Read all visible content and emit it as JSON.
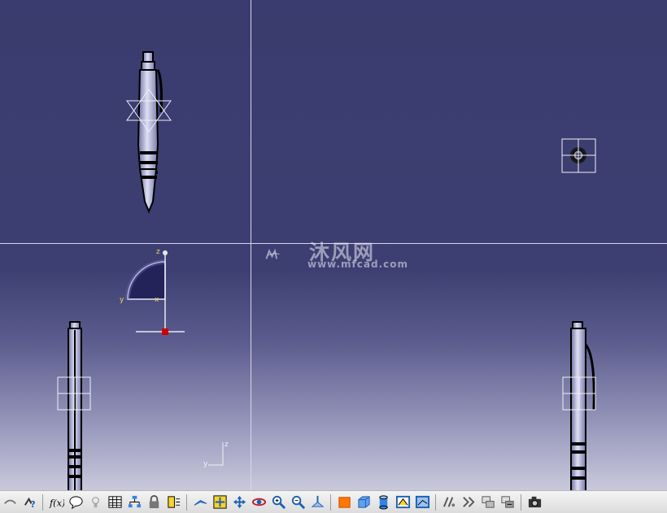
{
  "window": {
    "app": "3D CAD part viewer",
    "layout": "four-view"
  },
  "watermark": {
    "brand": "沐风网",
    "url": "www.mfcad.com"
  },
  "compass": {
    "x_label": "x",
    "y_label": "y",
    "z_label": "z"
  },
  "triad": {
    "y_label": "y",
    "z_label": "z"
  },
  "views": [
    {
      "name": "top-left",
      "content": "pen-front-view"
    },
    {
      "name": "top-right",
      "content": "pen-end-view"
    },
    {
      "name": "bottom-left",
      "content": "pen-side-view"
    },
    {
      "name": "bottom-right",
      "content": "pen-clip-view"
    }
  ],
  "toolbar": {
    "icons": [
      "link-icon",
      "help-icon",
      "formula-icon",
      "comment-icon",
      "light-icon",
      "table-icon",
      "tree-icon",
      "lock-icon",
      "grid-icon",
      "fly-icon",
      "fit-all-icon",
      "pan-icon",
      "rotate-icon",
      "zoom-in-icon",
      "zoom-out-icon",
      "normal-view-icon",
      "iso-view-icon",
      "box-view-icon",
      "cylinder-view-icon",
      "shade-icon",
      "edges-icon",
      "hide-show-icon",
      "swap-icon",
      "layer-icon",
      "layer-filter-icon",
      "camera-icon"
    ]
  },
  "colors": {
    "background_top": "#3a3b6e",
    "background_bottom": "#c9c9dc",
    "part_fill": "#cfd0ec",
    "part_edge": "#000000",
    "axis_label": "#f2d25a",
    "origin_marker": "#cc0000"
  }
}
